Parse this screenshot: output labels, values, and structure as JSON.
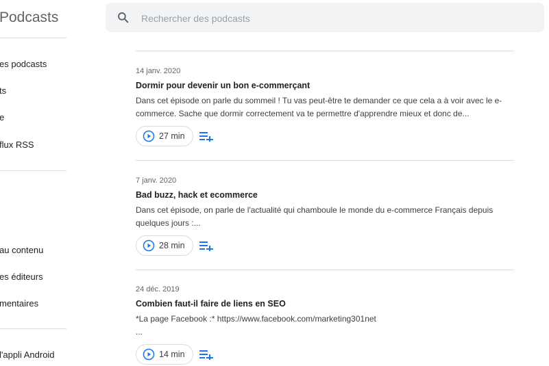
{
  "app": {
    "title": "Podcasts"
  },
  "sidebar": {
    "items": [
      {
        "label": "es podcasts"
      },
      {
        "label": "ts"
      },
      {
        "label": "e"
      },
      {
        "label": "flux RSS"
      },
      {
        "label": "au contenu"
      },
      {
        "label": "es éditeurs"
      },
      {
        "label": "mentaires"
      },
      {
        "label": "l'appli Android"
      }
    ]
  },
  "search": {
    "placeholder": "Rechercher des podcasts",
    "value": ""
  },
  "episodes": [
    {
      "date": "14 janv. 2020",
      "title": "Dormir pour devenir un bon e-commerçant",
      "description": "Dans cet épisode on parle du sommeil ! Tu vas peut-être te demander ce que cela a à voir avec le e-commerce. Sache que dormir correctement va te permettre d'apprendre mieux et donc de...",
      "duration": "27 min"
    },
    {
      "date": "7 janv. 2020",
      "title": "Bad buzz, hack et ecommerce",
      "description": "Dans cet épisode, on parle de l'actualité qui chamboule le monde du e-commerce Français depuis quelques jours :...",
      "duration": "28 min"
    },
    {
      "date": "24 déc. 2019",
      "title": "Combien faut-il faire de liens en SEO",
      "description": "*La page Facebook :* https://www.facebook.com/marketing301net\n...",
      "duration": "14 min"
    }
  ],
  "colors": {
    "accent": "#1a73e8",
    "divider": "#dadce0",
    "search_bg": "#f1f3f4"
  },
  "icons": {
    "search": "search-icon",
    "play": "play-circle-icon",
    "queue": "add-to-queue-icon"
  }
}
